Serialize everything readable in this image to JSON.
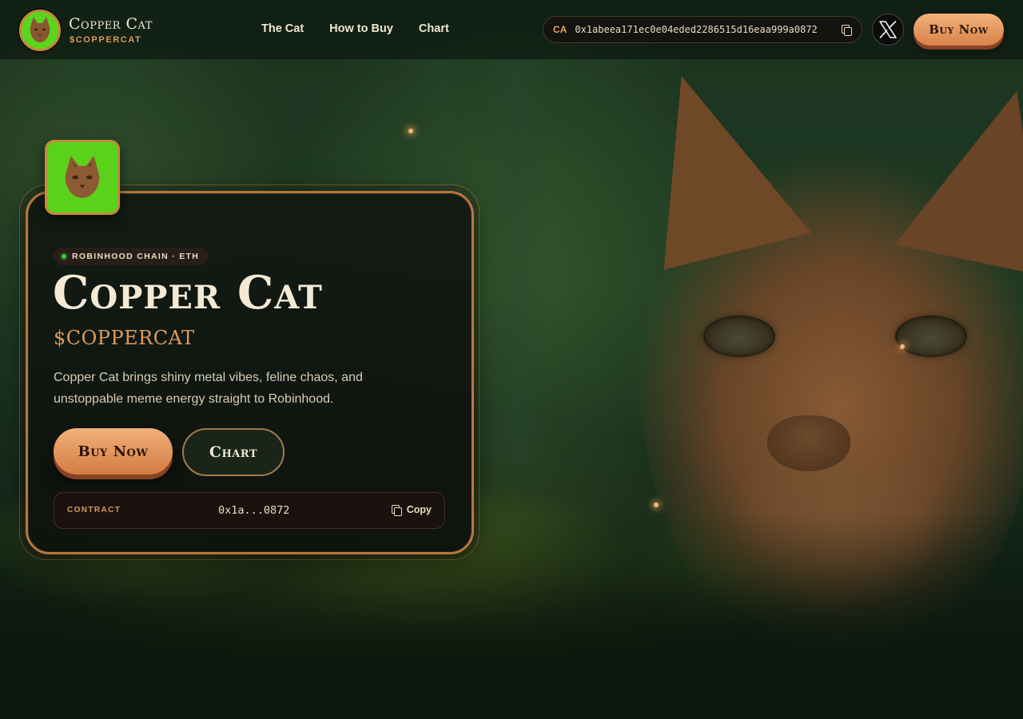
{
  "brand": {
    "name": "Copper Cat",
    "ticker": "$COPPERCAT"
  },
  "nav": {
    "items": [
      {
        "label": "The Cat"
      },
      {
        "label": "How to Buy"
      },
      {
        "label": "Chart"
      }
    ]
  },
  "header": {
    "ca_label": "CA",
    "ca_address": "0x1abeea171ec0e04eded2286515d16eaa999a0872",
    "buy_label": "Buy Now",
    "x_icon": "x-logo-icon"
  },
  "hero": {
    "chain_badge": "ROBINHOOD CHAIN · ETH",
    "title": "Copper Cat",
    "ticker": "$COPPERCAT",
    "description": "Copper Cat brings shiny metal vibes, feline chaos, and unstoppable meme energy straight to Robinhood.",
    "buy_label": "Buy Now",
    "chart_label": "Chart",
    "contract": {
      "label": "CONTRACT",
      "value": "0x1a...0872",
      "copy_label": "Copy"
    }
  },
  "colors": {
    "accent": "#d99a5c",
    "button": "#e99a62",
    "avatar_bg": "#5ad21a",
    "status_dot": "#3cc83c"
  }
}
